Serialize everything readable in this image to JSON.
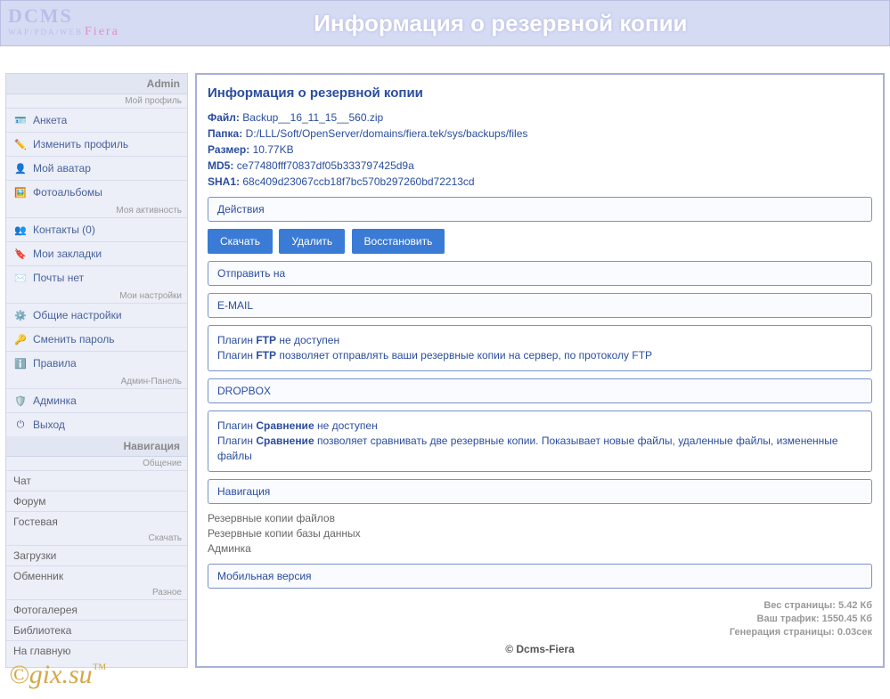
{
  "header": {
    "logo_top": "DCMS",
    "logo_bot": "WAP/PDA/WEB",
    "logo_fiera": "Fiera",
    "title": "Информация о резервной копии"
  },
  "sidebar": {
    "admin_header": "Admin",
    "sub_profile": "Мой профиль",
    "items_profile": [
      {
        "icon": "card",
        "label": "Анкета"
      },
      {
        "icon": "edit",
        "label": "Изменить профиль"
      },
      {
        "icon": "avatar",
        "label": "Мой аватар"
      },
      {
        "icon": "photo",
        "label": "Фотоальбомы"
      }
    ],
    "sub_activity": "Моя активность",
    "items_activity": [
      {
        "icon": "contact",
        "label": "Контакты (0)"
      },
      {
        "icon": "bookmark",
        "label": "Мои закладки"
      },
      {
        "icon": "mail",
        "label": "Почты нет"
      }
    ],
    "sub_settings": "Мои настройки",
    "items_settings": [
      {
        "icon": "gear",
        "label": "Общие настройки"
      },
      {
        "icon": "key",
        "label": "Сменить пароль"
      },
      {
        "icon": "info",
        "label": "Правила"
      }
    ],
    "sub_adminpanel": "Админ-Панель",
    "items_adminpanel": [
      {
        "icon": "admin",
        "label": "Админка"
      },
      {
        "icon": "power",
        "label": "Выход"
      }
    ],
    "nav_header": "Навигация",
    "sub_chat": "Общение",
    "items_chat": [
      "Чат",
      "Форум",
      "Гостевая"
    ],
    "sub_download": "Скачать",
    "items_download": [
      "Загрузки",
      "Обменник"
    ],
    "sub_misc": "Разное",
    "items_misc": [
      "Фотогалерея",
      "Библиотека",
      "На главную"
    ]
  },
  "content": {
    "title": "Информация о резервной копии",
    "file_label": "Файл:",
    "file_value": "Backup__16_11_15__560.zip",
    "folder_label": "Папка:",
    "folder_value": "D:/LLL/Soft/OpenServer/domains/fiera.tek/sys/backups/files",
    "size_label": "Размер:",
    "size_value": "10.77KB",
    "md5_label": "MD5:",
    "md5_value": "ce77480fff70837df05b333797425d9a",
    "sha1_label": "SHA1:",
    "sha1_value": "68c409d23067ccb18f7bc570b297260bd72213cd",
    "actions_title": "Действия",
    "btn_download": "Скачать",
    "btn_delete": "Удалить",
    "btn_restore": "Восстановить",
    "send_to": "Отправить на",
    "email": "E-MAIL",
    "ftp_line1_a": "Плагин ",
    "ftp_line1_b": "FTP",
    "ftp_line1_c": " не доступен",
    "ftp_line2_a": "Плагин ",
    "ftp_line2_b": "FTP",
    "ftp_line2_c": " позволяет отправлять ваши резервные копии на сервер, по протоколу FTP",
    "dropbox": "DROPBOX",
    "cmp_line1_a": "Плагин ",
    "cmp_line1_b": "Сравнение",
    "cmp_line1_c": " не доступен",
    "cmp_line2_a": "Плагин ",
    "cmp_line2_b": "Сравнение",
    "cmp_line2_c": " позволяет сравнивать две резервные копии. Показывает новые файлы, удаленные файлы, измененные файлы",
    "nav_title": "Навигация",
    "nav_links": [
      "Резервные копии файлов",
      "Резервные копии базы данных",
      "Админка"
    ],
    "mobile": "Мобильная версия",
    "stat_weight": "Вес страницы: 5.42 Кб",
    "stat_traffic": "Ваш трафик: 1550.45 Кб",
    "stat_gen": "Генерация страницы: 0.03сек",
    "copyright": "© Dcms-Fiera"
  },
  "watermark": "©gix.su™",
  "icons": {
    "card": "🪪",
    "edit": "✏️",
    "avatar": "👤",
    "photo": "🖼️",
    "contact": "👥",
    "bookmark": "🔖",
    "mail": "✉️",
    "gear": "⚙️",
    "key": "🔑",
    "info": "ℹ️",
    "admin": "🛡️",
    "power": "⏻"
  }
}
